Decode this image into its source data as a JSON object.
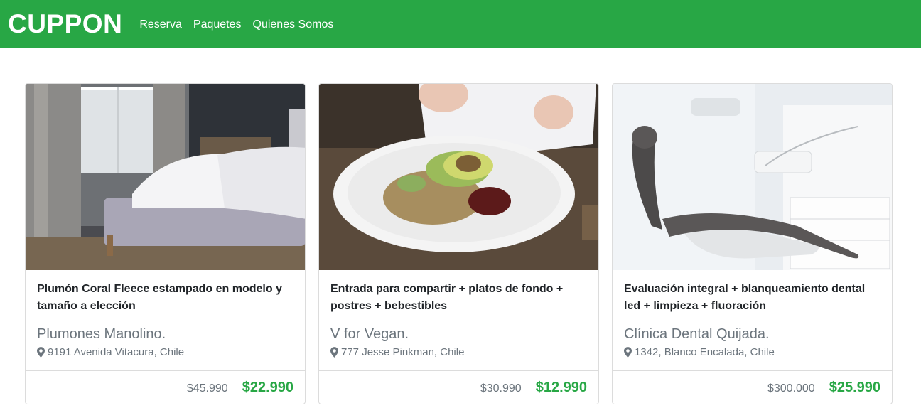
{
  "brand": "CUPPON",
  "nav": [
    "Reserva",
    "Paquetes",
    "Quienes Somos"
  ],
  "cards": [
    {
      "title": "Plumón Coral Fleece estampado en modelo y tamaño a elección",
      "merchant": "Plumones Manolino.",
      "address": "9191 Avenida Vitacura, Chile",
      "old_price": "$45.990",
      "new_price": "$22.990",
      "image": "bedroom-photo"
    },
    {
      "title": "Entrada para compartir + platos de fondo + postres + bebestibles",
      "merchant": "V for Vegan.",
      "address": "777 Jesse Pinkman, Chile",
      "old_price": "$30.990",
      "new_price": "$12.990",
      "image": "vegan-salad-photo"
    },
    {
      "title": "Evaluación integral + blanqueamiento dental led + limpieza + fluoración",
      "merchant": "Clínica Dental Quijada.",
      "address": "1342, Blanco Encalada, Chile",
      "old_price": "$300.000",
      "new_price": "$25.990",
      "image": "dental-chair-photo"
    }
  ],
  "colors": {
    "primary": "#28a745",
    "muted": "#6c757d"
  },
  "icons": {
    "address": "map-marker-icon"
  }
}
